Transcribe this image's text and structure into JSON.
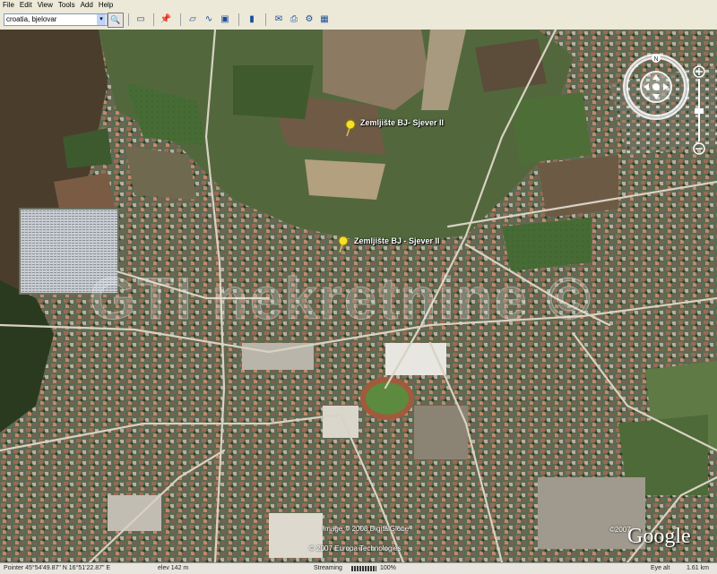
{
  "menu": [
    "File",
    "Edit",
    "View",
    "Tools",
    "Add",
    "Help"
  ],
  "search": {
    "value": "croatia, bjelovar"
  },
  "pins": [
    {
      "label": "Zemljište BJ- Sjever II"
    },
    {
      "label": "Zemljište BJ - Sjever II"
    }
  ],
  "watermark": "GTI nekretnine ©",
  "copyright": {
    "image": "Image © 2008 DigitalGlobe",
    "europe": "© 2007 Europa Technologies",
    "year": "©2007",
    "logo": "Google"
  },
  "status": {
    "pointer": "Pointer  45°54'49.87\" N    16°51'22.87\" E",
    "elev": "elev  142 m",
    "streaming": "Streaming",
    "percent": "100%",
    "eye": "Eye alt",
    "eye_value": "1.61 km"
  },
  "colors": {
    "pin": "#f5e12a",
    "label": "#ffffff",
    "map_base": "#4a5a3a"
  },
  "icons": [
    "search-icon",
    "sidebar-icon",
    "placemark-icon",
    "polygon-icon",
    "path-icon",
    "overlay-icon",
    "ruler-icon",
    "email-icon",
    "print-icon",
    "kml-icon",
    "maps-icon",
    "compass-icon"
  ]
}
